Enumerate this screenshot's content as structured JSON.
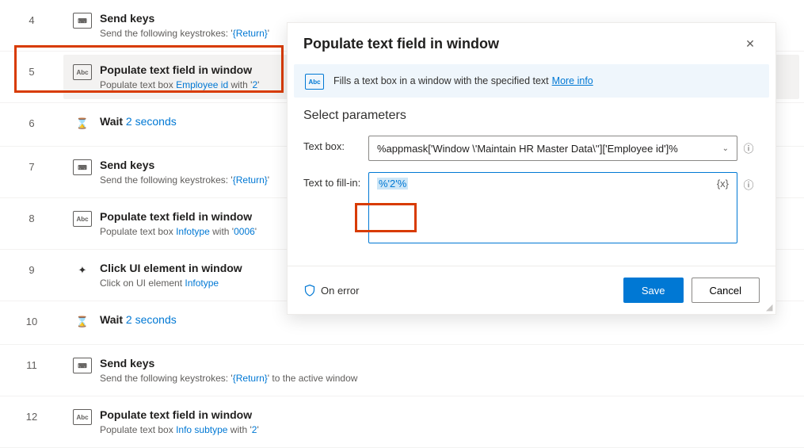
{
  "steps": [
    {
      "num": "4",
      "iconType": "box",
      "iconText": "⌨",
      "title": "Send keys",
      "sub_pre": "Send the following keystrokes: '",
      "sub_var": "{Return}",
      "sub_post": "'"
    },
    {
      "num": "5",
      "iconType": "box",
      "iconText": "Abc",
      "title": "Populate text field in window",
      "sub_pre": "Populate text box ",
      "sub_var": "Employee id",
      "sub_post": " with '",
      "sub_var2": "2",
      "sub_post2": "'",
      "selected": true
    },
    {
      "num": "6",
      "iconType": "plain",
      "iconText": "⌛",
      "title": "Wait",
      "title_var": "2 seconds"
    },
    {
      "num": "7",
      "iconType": "box",
      "iconText": "⌨",
      "title": "Send keys",
      "sub_pre": "Send the following keystrokes: '",
      "sub_var": "{Return}",
      "sub_post": "'"
    },
    {
      "num": "8",
      "iconType": "box",
      "iconText": "Abc",
      "title": "Populate text field in window",
      "sub_pre": "Populate text box ",
      "sub_var": "Infotype",
      "sub_post": " with '",
      "sub_var2": "0006",
      "sub_post2": "'"
    },
    {
      "num": "9",
      "iconType": "plain",
      "iconText": "✦",
      "title": "Click UI element in window",
      "sub_pre": "Click on UI element ",
      "sub_var": "Infotype"
    },
    {
      "num": "10",
      "iconType": "plain",
      "iconText": "⌛",
      "title": "Wait",
      "title_var": "2 seconds"
    },
    {
      "num": "11",
      "iconType": "box",
      "iconText": "⌨",
      "title": "Send keys",
      "sub_pre": "Send the following keystrokes: '",
      "sub_var": "{Return}",
      "sub_post": "' to the active window"
    },
    {
      "num": "12",
      "iconType": "box",
      "iconText": "Abc",
      "title": "Populate text field in window",
      "sub_pre": "Populate text box ",
      "sub_var": "Info subtype",
      "sub_post": " with '",
      "sub_var2": "2",
      "sub_post2": "'"
    }
  ],
  "dialog": {
    "title": "Populate text field in window",
    "banner_icon": "Abc",
    "banner_text": "Fills a text box in a window with the specified text",
    "banner_link": "More info",
    "section_title": "Select parameters",
    "param1_label": "Text box:",
    "param1_value": "%appmask['Window \\'Maintain HR Master Data\\'']['Employee id']%",
    "param2_label": "Text to fill-in:",
    "param2_value": "%'2'%",
    "fx_label": "{x}",
    "onerror": "On error",
    "save": "Save",
    "cancel": "Cancel"
  }
}
